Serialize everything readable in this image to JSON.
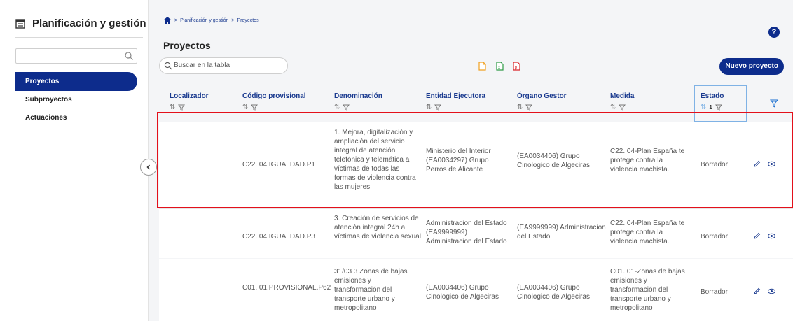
{
  "sidebar": {
    "title": "Planificación y gestión",
    "search_placeholder": "",
    "items": [
      {
        "label": "Proyectos",
        "active": true
      },
      {
        "label": "Subproyectos",
        "active": false
      },
      {
        "label": "Actuaciones",
        "active": false
      }
    ]
  },
  "breadcrumb": {
    "items": [
      "Planificación y gestión",
      "Proyectos"
    ],
    "separator": ">"
  },
  "page": {
    "title": "Proyectos",
    "help": "?"
  },
  "toolbar": {
    "search_placeholder": "Buscar en la tabla",
    "new_button": "Nuevo proyecto",
    "export_icons": [
      "file-icon",
      "excel-icon",
      "pdf-icon"
    ]
  },
  "table": {
    "columns": [
      "Localizador",
      "Código provisional",
      "Denominación",
      "Entidad Ejecutora",
      "Órgano Gestor",
      "Medida",
      "Estado"
    ],
    "estado_sort_badge": "1",
    "rows": [
      {
        "localizador": "",
        "codigo": "C22.I04.IGUALDAD.P1",
        "denominacion": "1. Mejora, digitalización y ampliación del servicio integral de atención telefónica y telemática a víctimas de todas las formas de violencia contra las mujeres",
        "entidad": "Ministerio del Interior (EA0034297) Grupo Perros de Alicante",
        "organo": "(EA0034406) Grupo Cinologico de Algeciras",
        "medida": "C22.I04-Plan España te protege contra la violencia machista.",
        "estado": "Borrador"
      },
      {
        "localizador": "",
        "codigo": "C22.I04.IGUALDAD.P3",
        "denominacion": "3. Creación de servicios de atención integral 24h a víctimas de violencia sexual",
        "entidad": "Administracion del Estado (EA9999999) Administracion del Estado",
        "organo": "(EA9999999) Administracion del Estado",
        "medida": "C22.I04-Plan España te protege contra la violencia machista.",
        "estado": "Borrador"
      },
      {
        "localizador": "",
        "codigo": "C01.I01.PROVISIONAL.P62",
        "denominacion": "31/03 3 Zonas de bajas emisiones y transformación del transporte urbano y metropolitano",
        "entidad": "(EA0034406) Grupo Cinologico de Algeciras",
        "organo": "(EA0034406) Grupo Cinologico de Algeciras",
        "medida": "C01.I01-Zonas de bajas emisiones y transformación del transporte urbano y metropolitano",
        "estado": "Borrador"
      }
    ]
  },
  "colors": {
    "primary": "#0d2c8c",
    "link": "#1a3a8f",
    "highlight": "#e3101b",
    "background": "#f4f5f7"
  }
}
